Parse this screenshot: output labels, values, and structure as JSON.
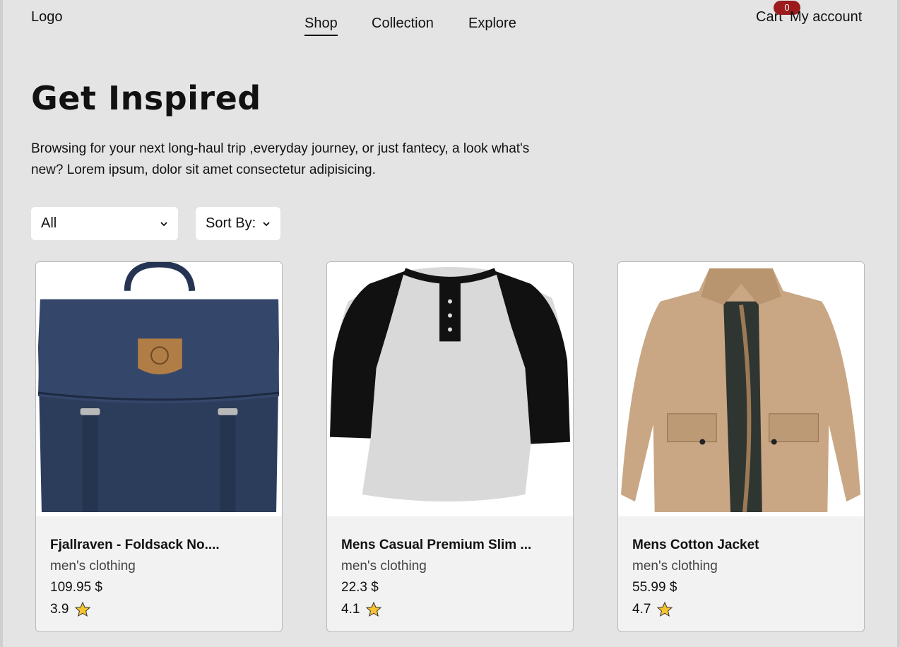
{
  "header": {
    "logo": "Logo",
    "nav": [
      {
        "label": "Shop",
        "active": true
      },
      {
        "label": "Collection",
        "active": false
      },
      {
        "label": "Explore",
        "active": false
      }
    ],
    "cart_label": "Cart",
    "cart_count": "0",
    "account_label": "My account",
    "badge_color": "#9c1b1b"
  },
  "hero": {
    "title": "Get Inspired",
    "description": "Browsing for your next long-haul trip ,everyday journey, or just fantecy, a look what's new? Lorem ipsum, dolor sit amet consectetur adipisicing."
  },
  "filters": {
    "category_selected": "All",
    "sort_selected": "Sort By:"
  },
  "products": [
    {
      "title": "Fjallraven - Foldsack No....",
      "category": "men's clothing",
      "price": "109.95 $",
      "rating": "3.9",
      "image": "navy-backpack"
    },
    {
      "title": "Mens Casual Premium Slim ...",
      "category": "men's clothing",
      "price": "22.3 $",
      "rating": "4.1",
      "image": "raglan-henley-shirt"
    },
    {
      "title": "Mens Cotton Jacket",
      "category": "men's clothing",
      "price": "55.99 $",
      "rating": "4.7",
      "image": "beige-cotton-jacket"
    }
  ]
}
